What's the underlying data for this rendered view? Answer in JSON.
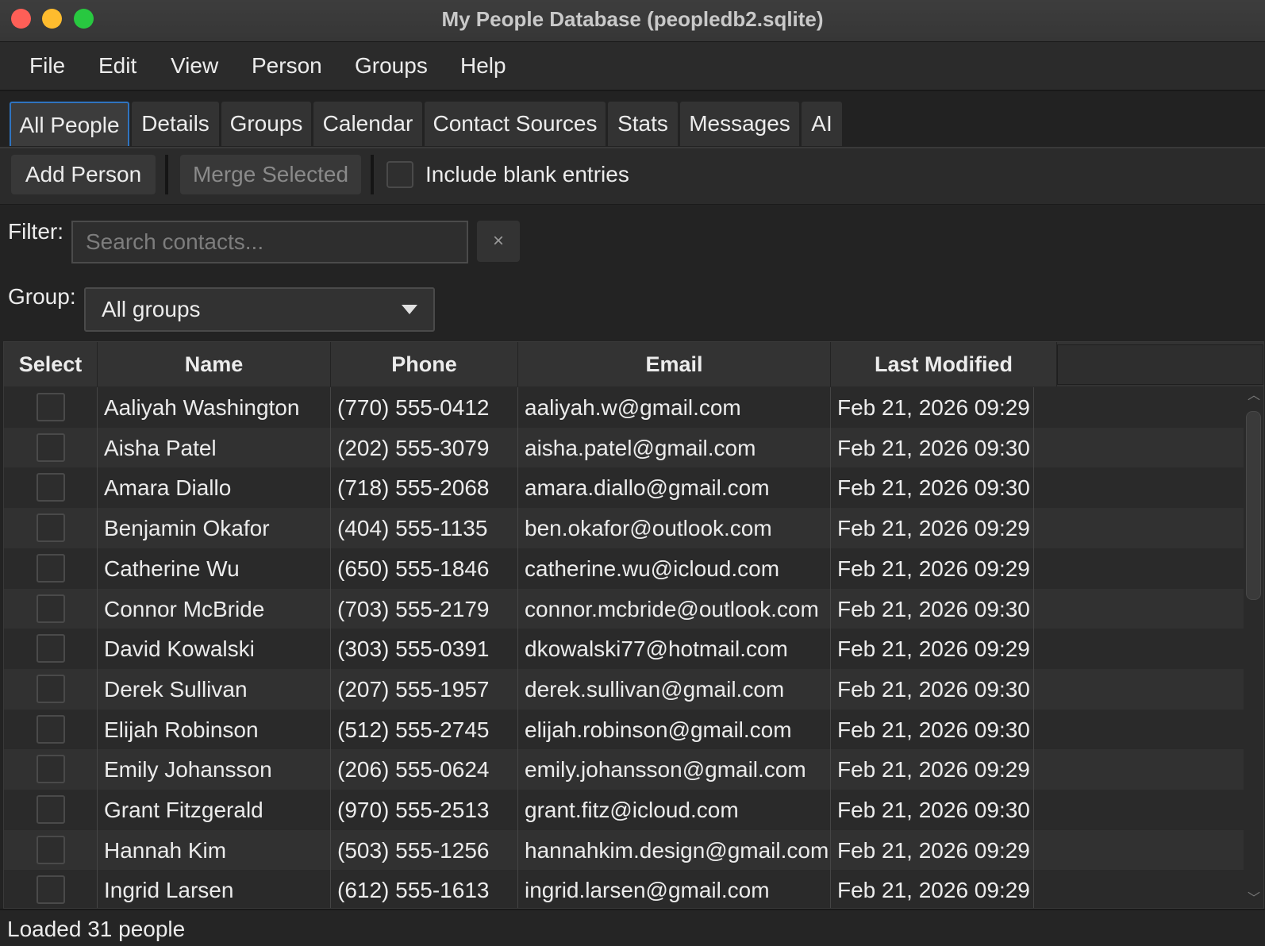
{
  "window": {
    "title": "My People Database (peopledb2.sqlite)"
  },
  "menu": [
    "File",
    "Edit",
    "View",
    "Person",
    "Groups",
    "Help"
  ],
  "tabs": [
    "All People",
    "Details",
    "Groups",
    "Calendar",
    "Contact Sources",
    "Stats",
    "Messages",
    "AI"
  ],
  "active_tab": "All People",
  "toolbar": {
    "add_label": "Add Person",
    "merge_label": "Merge Selected",
    "include_blank_label": "Include blank entries"
  },
  "filter": {
    "label": "Filter:",
    "placeholder": "Search contacts...",
    "clear": "×"
  },
  "group": {
    "label": "Group:",
    "selected": "All groups"
  },
  "table": {
    "headers": [
      "Select",
      "Name",
      "Phone",
      "Email",
      "Last Modified"
    ],
    "rows": [
      [
        "Aaliyah Washington",
        "(770) 555-0412",
        "aaliyah.w@gmail.com",
        "Feb 21, 2026 09:29"
      ],
      [
        "Aisha Patel",
        "(202) 555-3079",
        "aisha.patel@gmail.com",
        "Feb 21, 2026 09:30"
      ],
      [
        "Amara Diallo",
        "(718) 555-2068",
        "amara.diallo@gmail.com",
        "Feb 21, 2026 09:30"
      ],
      [
        "Benjamin Okafor",
        "(404) 555-1135",
        "ben.okafor@outlook.com",
        "Feb 21, 2026 09:29"
      ],
      [
        "Catherine Wu",
        "(650) 555-1846",
        "catherine.wu@icloud.com",
        "Feb 21, 2026 09:29"
      ],
      [
        "Connor McBride",
        "(703) 555-2179",
        "connor.mcbride@outlook.com",
        "Feb 21, 2026 09:30"
      ],
      [
        "David Kowalski",
        "(303) 555-0391",
        "dkowalski77@hotmail.com",
        "Feb 21, 2026 09:29"
      ],
      [
        "Derek Sullivan",
        "(207) 555-1957",
        "derek.sullivan@gmail.com",
        "Feb 21, 2026 09:30"
      ],
      [
        "Elijah Robinson",
        "(512) 555-2745",
        "elijah.robinson@gmail.com",
        "Feb 21, 2026 09:30"
      ],
      [
        "Emily Johansson",
        "(206) 555-0624",
        "emily.johansson@gmail.com",
        "Feb 21, 2026 09:29"
      ],
      [
        "Grant Fitzgerald",
        "(970) 555-2513",
        "grant.fitz@icloud.com",
        "Feb 21, 2026 09:30"
      ],
      [
        "Hannah Kim",
        "(503) 555-1256",
        "hannahkim.design@gmail.com",
        "Feb 21, 2026 09:29"
      ],
      [
        "Ingrid Larsen",
        "(612) 555-1613",
        "ingrid.larsen@gmail.com",
        "Feb 21, 2026 09:29"
      ]
    ]
  },
  "status": "Loaded 31 people",
  "colors": {
    "accent": "#2f74c0",
    "close": "#fe5f57",
    "minimize": "#febc2e",
    "maximize": "#28c840"
  }
}
